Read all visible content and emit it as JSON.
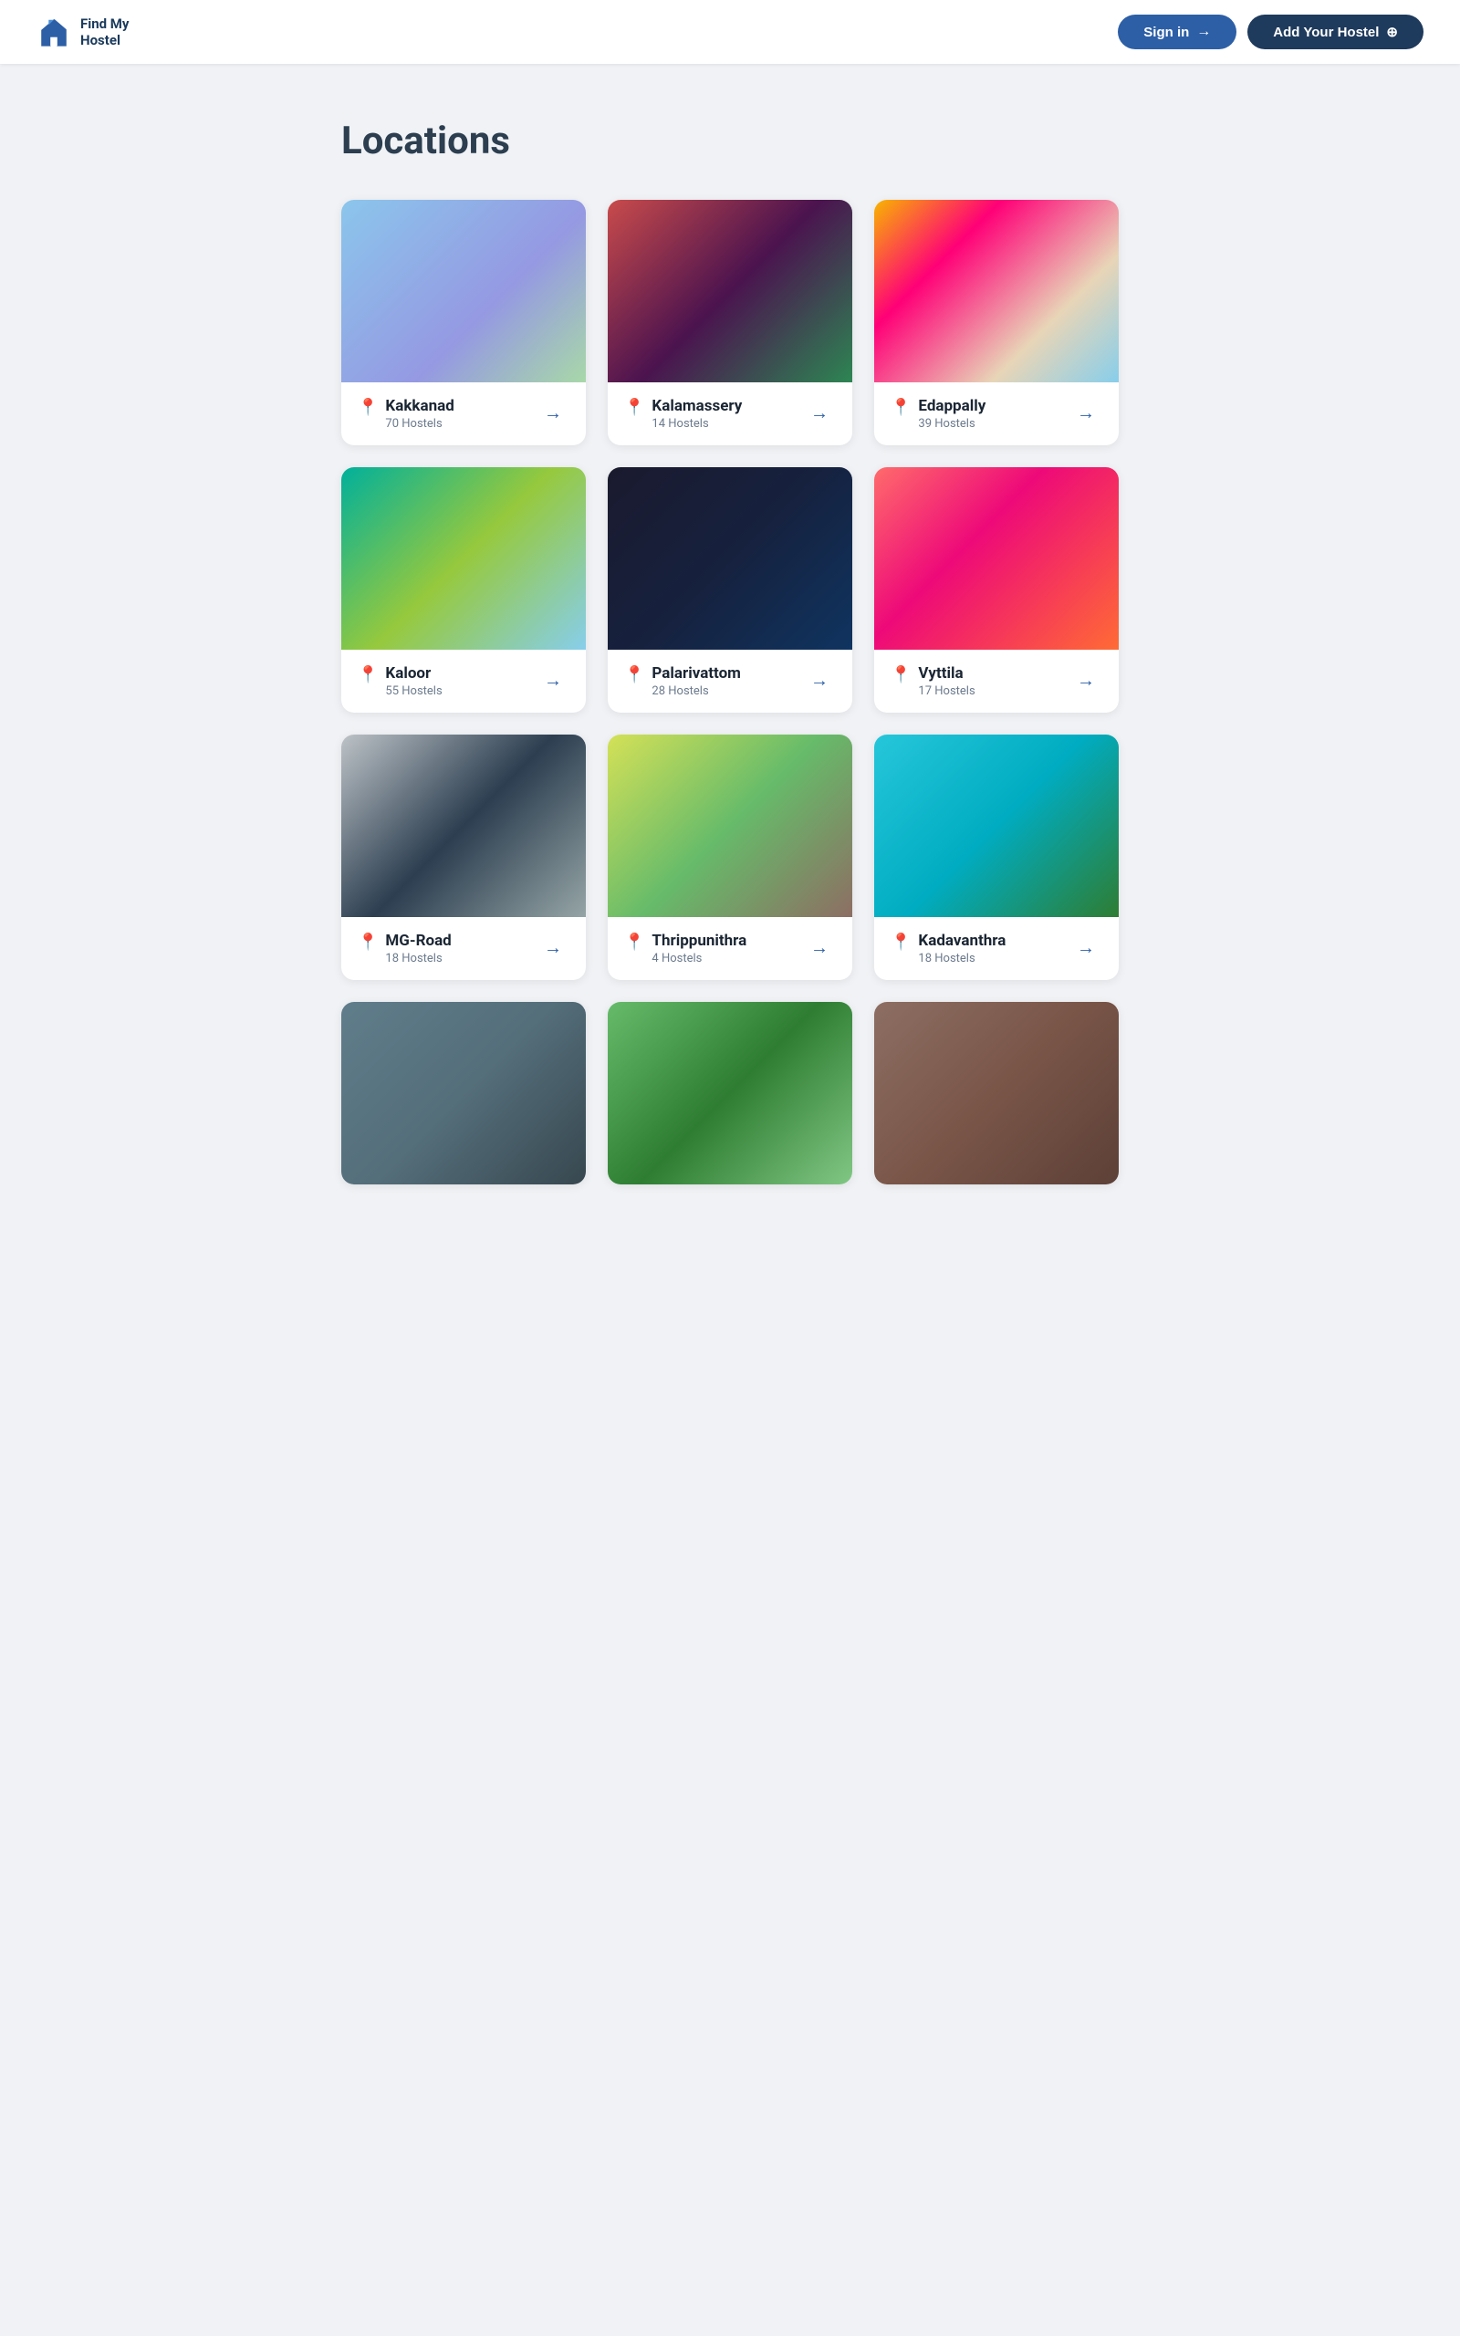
{
  "header": {
    "logo_text_line1": "Find My",
    "logo_text_line2": "Hostel",
    "signin_label": "Sign in",
    "add_hostel_label": "Add Your Hostel"
  },
  "main": {
    "page_title": "Locations",
    "locations": [
      {
        "id": "kakkanad",
        "name": "Kakkanad",
        "count": "70 Hostels",
        "img_class": "img-kakkanad"
      },
      {
        "id": "kalamassery",
        "name": "Kalamassery",
        "count": "14 Hostels",
        "img_class": "img-kalamassery"
      },
      {
        "id": "edappally",
        "name": "Edappally",
        "count": "39 Hostels",
        "img_class": "img-edappally"
      },
      {
        "id": "kaloor",
        "name": "Kaloor",
        "count": "55 Hostels",
        "img_class": "img-kaloor"
      },
      {
        "id": "palarivattom",
        "name": "Palarivattom",
        "count": "28 Hostels",
        "img_class": "img-palarivattom"
      },
      {
        "id": "vyttila",
        "name": "Vyttila",
        "count": "17 Hostels",
        "img_class": "img-vyttila"
      },
      {
        "id": "mg-road",
        "name": "MG-Road",
        "count": "18 Hostels",
        "img_class": "img-mgroad"
      },
      {
        "id": "thrippunithra",
        "name": "Thrippunithra",
        "count": "4 Hostels",
        "img_class": "img-thrippunithra"
      },
      {
        "id": "kadavanthra",
        "name": "Kadavanthra",
        "count": "18 Hostels",
        "img_class": "img-kadavanthra"
      },
      {
        "id": "row4-1",
        "name": "",
        "count": "",
        "img_class": "img-row4-1"
      },
      {
        "id": "row4-2",
        "name": "",
        "count": "",
        "img_class": "img-row4-2"
      },
      {
        "id": "row4-3",
        "name": "",
        "count": "",
        "img_class": "img-row4-3"
      }
    ]
  }
}
